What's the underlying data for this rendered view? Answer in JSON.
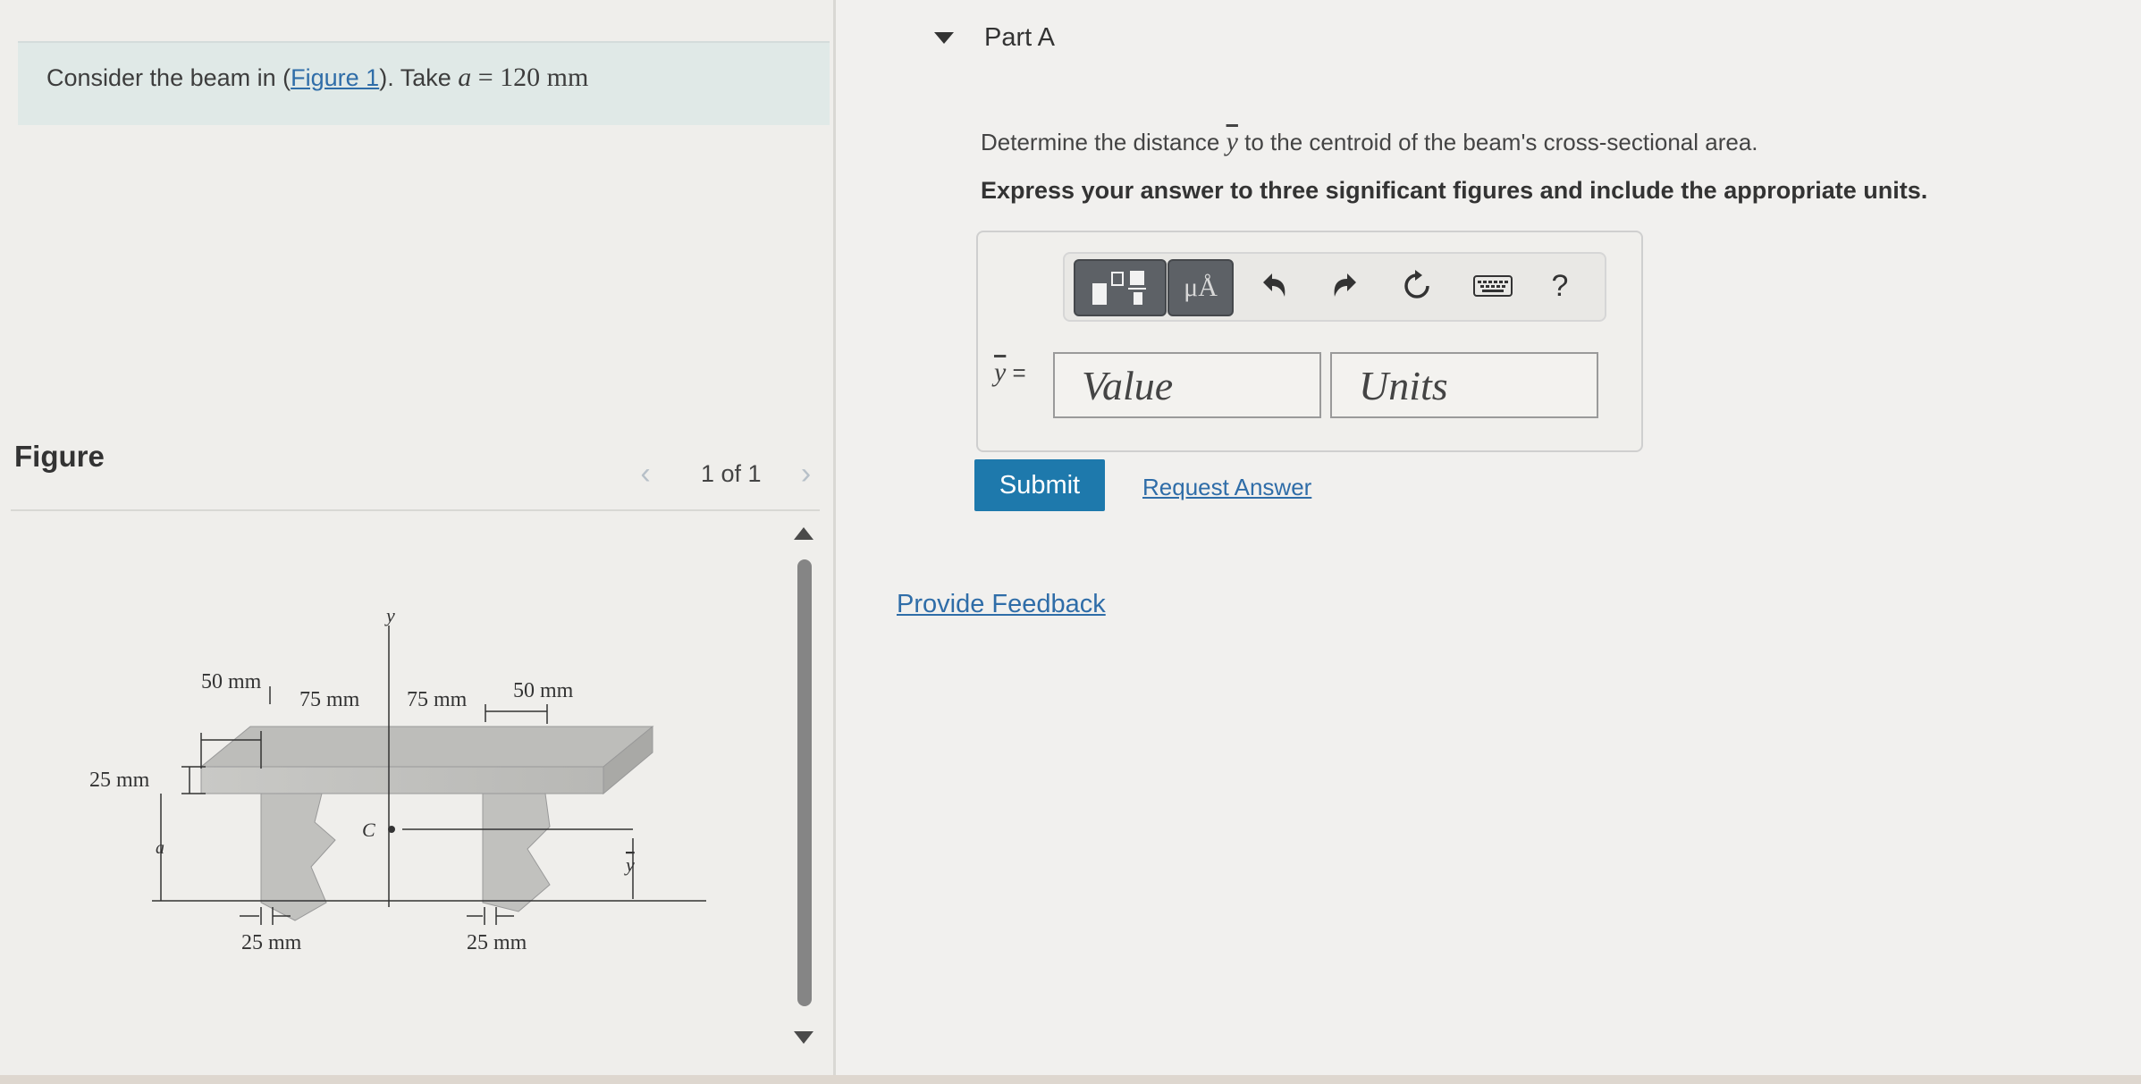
{
  "problem": {
    "intro": "Consider the beam in (",
    "figure_link": "Figure 1",
    "mid": "). Take ",
    "var": "a",
    "eq": " = 120 ",
    "unit": "mm"
  },
  "figure_panel": {
    "title": "Figure",
    "pager_text": "1 of 1"
  },
  "figure": {
    "label_50_left": "50 mm",
    "label_75_left": "75 mm",
    "label_75_right": "75 mm",
    "label_50_right": "50 mm",
    "label_25_top": "25 mm",
    "label_a": "a",
    "label_y_axis": "y",
    "label_c": "C",
    "label_ybar": "y",
    "label_25_bottom_left": "25 mm",
    "label_25_bottom_right": "25 mm"
  },
  "part": {
    "title": "Part A",
    "question_prefix": "Determine the distance ",
    "question_var": "y",
    "question_suffix": " to the centroid of the beam's cross-sectional area.",
    "instruction": "Express your answer to three significant figures and include the appropriate units."
  },
  "toolbar": {
    "units_label": "μÅ",
    "help_label": "?"
  },
  "answer": {
    "var_label": "y",
    "eq_sign": " =",
    "value_placeholder": "Value",
    "units_placeholder": "Units"
  },
  "actions": {
    "submit_label": "Submit",
    "request_answer_label": "Request Answer",
    "feedback_label": "Provide Feedback"
  }
}
